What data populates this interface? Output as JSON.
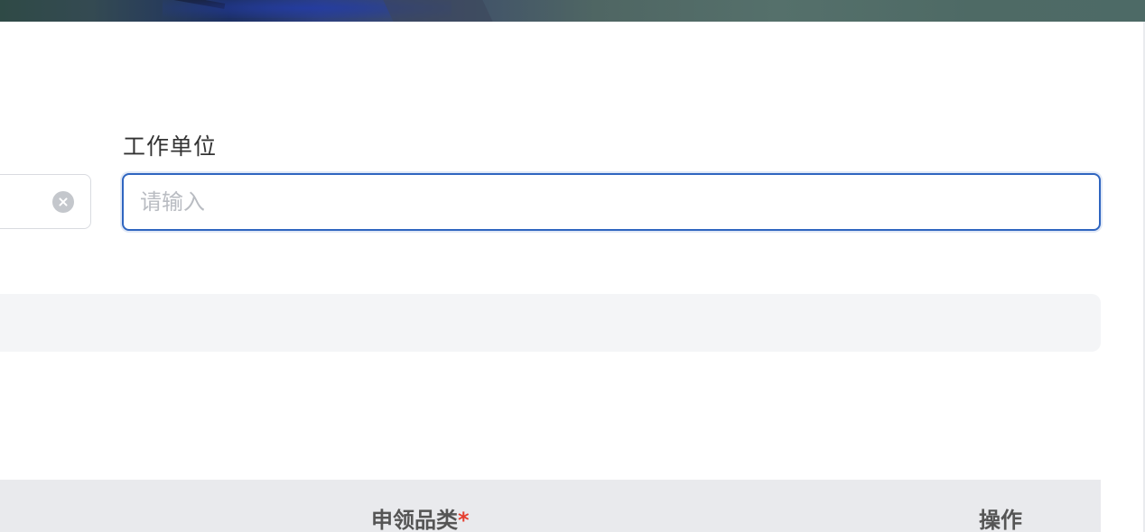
{
  "form": {
    "work_unit": {
      "label": "工作单位",
      "value": "",
      "placeholder": "请输入"
    }
  },
  "table": {
    "columns": [
      {
        "label": "申领品类",
        "required_mark": "*"
      },
      {
        "label": "操作"
      }
    ]
  },
  "colors": {
    "accent": "#2f65c0",
    "required": "#e53e2f",
    "header_bg": "#e9eaed"
  }
}
